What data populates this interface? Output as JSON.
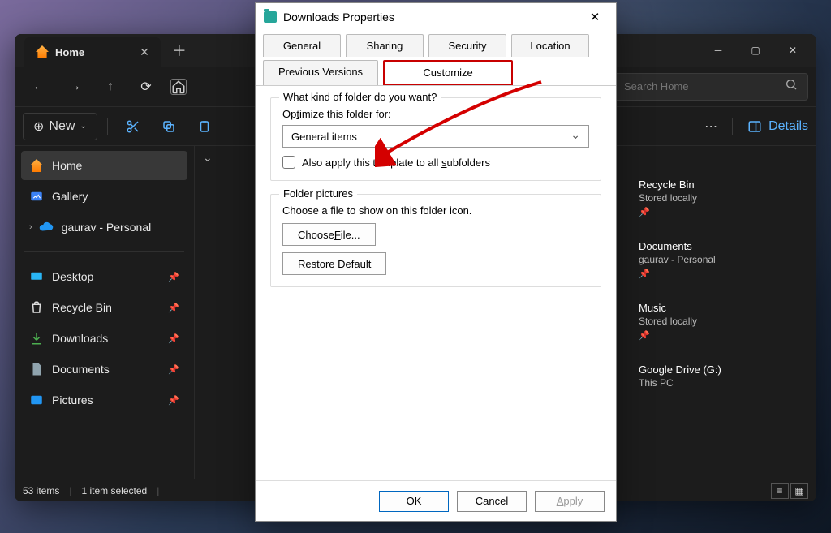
{
  "explorer": {
    "tab_title": "Home",
    "nav": {
      "search_placeholder": "Search Home"
    },
    "toolbar": {
      "new_label": "New",
      "details_label": "Details"
    },
    "sidebar": {
      "items": [
        {
          "label": "Home"
        },
        {
          "label": "Gallery"
        },
        {
          "label": "gaurav - Personal"
        }
      ],
      "pinned": [
        {
          "label": "Desktop"
        },
        {
          "label": "Recycle Bin"
        },
        {
          "label": "Downloads"
        },
        {
          "label": "Documents"
        },
        {
          "label": "Pictures"
        }
      ]
    },
    "rightpanel": {
      "items": [
        {
          "title": "Recycle Bin",
          "sub": "Stored locally"
        },
        {
          "title": "Documents",
          "sub": "gaurav - Personal"
        },
        {
          "title": "Music",
          "sub": "Stored locally"
        },
        {
          "title": "Google Drive (G:)",
          "sub": "This PC"
        }
      ]
    },
    "status": {
      "count": "53 items",
      "selection": "1 item selected"
    }
  },
  "dialog": {
    "title": "Downloads Properties",
    "tabs_row1": [
      "General",
      "Sharing",
      "Security",
      "Location"
    ],
    "tabs_row2": [
      "Previous Versions",
      "Customize"
    ],
    "active_tab": "Customize",
    "group1_title": "What kind of folder do you want?",
    "optimize_label": "Optimize this folder for:",
    "optimize_value": "General items",
    "also_apply": "Also apply this template to all subfolders",
    "group2_title": "Folder pictures",
    "choose_msg": "Choose a file to show on this folder icon.",
    "choose_file": "Choose File...",
    "restore_default": "Restore Default",
    "ok": "OK",
    "cancel": "Cancel",
    "apply": "Apply"
  }
}
